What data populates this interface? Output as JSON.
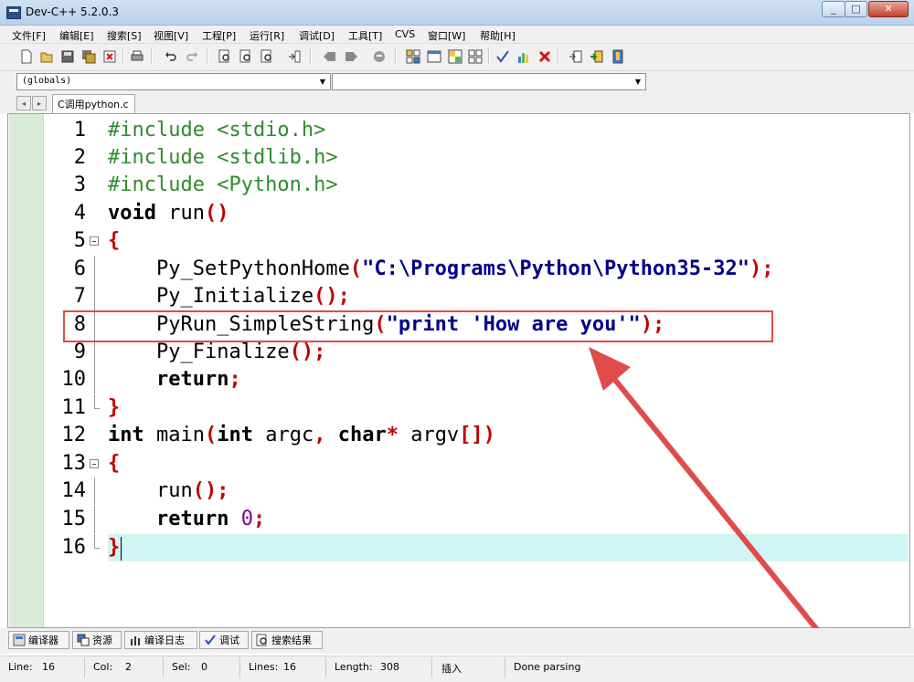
{
  "window": {
    "title": "Dev-C++ 5.2.0.3",
    "minimize": "_",
    "maximize": "□",
    "close": "✕"
  },
  "menu": [
    "文件[F]",
    "编辑[E]",
    "搜索[S]",
    "视图[V]",
    "工程[P]",
    "运行[R]",
    "调试[D]",
    "工具[T]",
    "CVS",
    "窗口[W]",
    "帮助[H]"
  ],
  "toolbar": {
    "icons": [
      "new-file-icon",
      "open-file-icon",
      "save-icon",
      "save-all-icon",
      "close-file-icon",
      "print-icon",
      "undo-icon",
      "redo-icon",
      "find-icon",
      "find-next-icon",
      "replace-icon",
      "goto-line-icon",
      "prev-bookmark-icon",
      "next-bookmark-icon",
      "toggle-bookmark-icon",
      "compile-icon",
      "run-icon",
      "compile-run-icon",
      "rebuild-icon",
      "syntax-check-icon",
      "profile-icon",
      "delete-profile-icon",
      "insert-icon",
      "add-project-icon",
      "project-options-icon"
    ]
  },
  "combos": {
    "scope": "(globals)",
    "member": ""
  },
  "tabs": {
    "prev": "◂",
    "next": "▸",
    "active_file": "C调用python.c"
  },
  "editor": {
    "line_numbers": [
      "1",
      "2",
      "3",
      "4",
      "5",
      "6",
      "7",
      "8",
      "9",
      "10",
      "11",
      "12",
      "13",
      "14",
      "15",
      "16"
    ],
    "lines": {
      "l1": {
        "pp": "#include <stdio.h>"
      },
      "l2": {
        "pp": "#include <stdlib.h>"
      },
      "l3": {
        "pp": "#include <Python.h>"
      },
      "l4": {
        "kw": "void",
        "name": " run",
        "sym": "()"
      },
      "l5": {
        "sym": "{"
      },
      "l6": {
        "indent": "    ",
        "name": "Py_SetPythonHome",
        "open": "(",
        "str": "\"C:\\Programs\\Python\\Python35-32\"",
        "close": ");"
      },
      "l7": {
        "indent": "    ",
        "name": "Py_Initialize",
        "sym": "();"
      },
      "l8": {
        "indent": "    ",
        "name": "PyRun_SimpleString",
        "open": "(",
        "str": "\"print 'How are you'\"",
        "close": ");"
      },
      "l9": {
        "indent": "    ",
        "name": "Py_Finalize",
        "sym": "();"
      },
      "l10": {
        "indent": "    ",
        "kw": "return",
        "sym": ";"
      },
      "l11": {
        "sym": "}"
      },
      "l12": {
        "kw1": "int",
        "name1": " main",
        "open": "(",
        "kw2": "int",
        "name2": " argc",
        "comma": ", ",
        "kw3": "char",
        "star": "*",
        "name3": " argv",
        "close": "[])"
      },
      "l13": {
        "sym": "{"
      },
      "l14": {
        "indent": "    ",
        "name": "run",
        "sym": "();"
      },
      "l15": {
        "indent": "    ",
        "kw": "return",
        "num": " 0",
        "sym": ";"
      },
      "l16": {
        "sym": "}"
      }
    },
    "highlighted_line": "8",
    "current_line": "16",
    "accent_annotation": "#e04b4b",
    "current_line_color": "#cff5f5"
  },
  "bottom_tabs": [
    {
      "icon": "compiler-icon",
      "label": "编译器"
    },
    {
      "icon": "resources-icon",
      "label": "资源"
    },
    {
      "icon": "compile-log-icon",
      "label": "编译日志"
    },
    {
      "icon": "debug-icon",
      "label": "调试"
    },
    {
      "icon": "search-results-icon",
      "label": "搜索结果"
    }
  ],
  "status": {
    "line_label": "Line:",
    "line": "16",
    "col_label": "Col:",
    "col": "2",
    "sel_label": "Sel:",
    "sel": "0",
    "lines_label": "Lines:",
    "lines": "16",
    "length_label": "Length:",
    "length": "308",
    "mode": "插入",
    "message": "Done parsing"
  }
}
